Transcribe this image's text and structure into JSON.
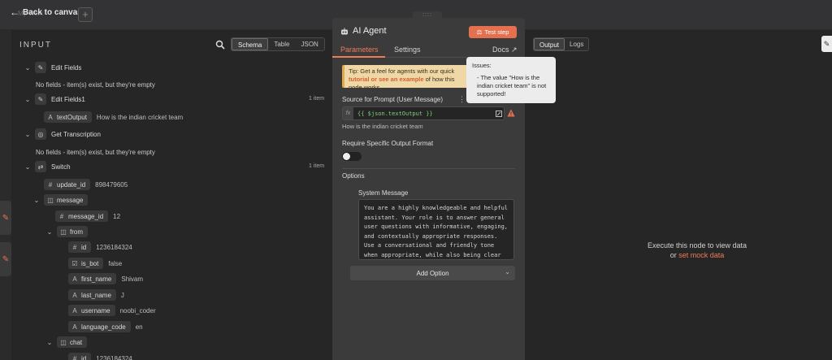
{
  "topbar": {
    "back_label": "Back to canvas",
    "ghost_label": "My Work"
  },
  "input": {
    "title": "INPUT",
    "views": [
      "Schema",
      "Table",
      "JSON"
    ],
    "active_view": "Schema",
    "nodes": {
      "edit_fields": {
        "label": "Edit Fields",
        "note": "No fields - item(s) exist, but they're empty"
      },
      "edit_fields1": {
        "label": "Edit Fields1",
        "count": "1 item",
        "field_name": "textOutput",
        "field_value": "How is the indian cricket team"
      },
      "get_transcription": {
        "label": "Get Transcription",
        "note": "No fields - item(s) exist, but they're empty"
      },
      "switch": {
        "label": "Switch",
        "count": "1 item"
      }
    },
    "fields": {
      "update_id": {
        "name": "update_id",
        "value": "898479605",
        "type": "#"
      },
      "message": {
        "name": "message"
      },
      "message_id": {
        "name": "message_id",
        "value": "12",
        "type": "#"
      },
      "from": {
        "name": "from"
      },
      "from_id": {
        "name": "id",
        "value": "1236184324",
        "type": "#"
      },
      "is_bot": {
        "name": "is_bot",
        "value": "false"
      },
      "first_name": {
        "name": "first_name",
        "value": "Shivam",
        "type": "A"
      },
      "last_name": {
        "name": "last_name",
        "value": "J",
        "type": "A"
      },
      "username": {
        "name": "username",
        "value": "noobi_coder",
        "type": "A"
      },
      "language_code": {
        "name": "language_code",
        "value": "en",
        "type": "A"
      },
      "chat": {
        "name": "chat"
      },
      "chat_id": {
        "name": "id",
        "value": "1236184324",
        "type": "#"
      }
    }
  },
  "node_panel": {
    "title": "AI Agent",
    "test_step_label": "Test step",
    "tabs": [
      "Parameters",
      "Settings"
    ],
    "active_tab": "Parameters",
    "docs_label": "Docs",
    "tip": {
      "text_before": "Tip: Get a feel for agents with our quick ",
      "link_text": "tutorial or see an example",
      "text_after": " of how this node works"
    },
    "prompt_label": "Source for Prompt (User Message)",
    "prompt_expression": "{{ $json.textOutput }}",
    "prompt_result": "How is the indian cricket team",
    "output_format_label": "Require Specific Output Format",
    "output_format_enabled": false,
    "options_label": "Options",
    "system_message_label": "System Message",
    "system_message": "You are a highly knowledgeable and helpful assistant. Your role is to answer general user questions with informative, engaging, and contextually appropriate responses. Use a conversational and friendly tone when appropriate, while also being clear",
    "add_option_label": "Add Option"
  },
  "issues_tooltip": {
    "heading": "Issues:",
    "body": "- The value \"How is the indian cricket team\" is not supported!"
  },
  "output": {
    "views": [
      "Output",
      "Logs"
    ],
    "active_view": "Output",
    "exec_text": "Execute this node to view data",
    "or_text": "or",
    "mock_link": "set mock data"
  },
  "colors": {
    "accent": "#ef7b58",
    "warning": "#e5704f",
    "expression": "#7ed07e"
  }
}
